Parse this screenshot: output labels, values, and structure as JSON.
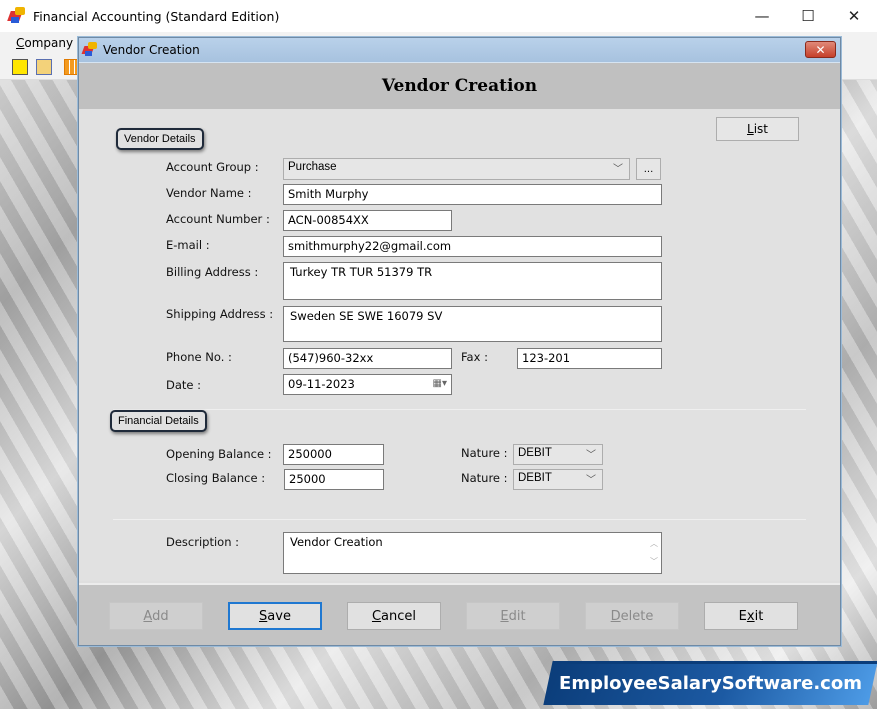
{
  "app": {
    "title": "Financial Accounting (Standard Edition)",
    "window_controls": {
      "minimize": "—",
      "maximize": "☐",
      "close": "✕"
    },
    "menu": [
      {
        "label": "Company",
        "mnemonic": "C"
      }
    ]
  },
  "dialog": {
    "title": "Vendor Creation",
    "close_label": "✕",
    "header_title": "Vendor Creation",
    "list_button": "List",
    "vendor_details": {
      "group_label": "Vendor Details",
      "account_group_label": "Account Group :",
      "account_group_value": "Purchase",
      "browse_button": "...",
      "vendor_name_label": "Vendor Name :",
      "vendor_name_value": "Smith Murphy",
      "account_number_label": "Account Number :",
      "account_number_value": "ACN-00854XX",
      "email_label": "E-mail :",
      "email_value": "smithmurphy22@gmail.com",
      "billing_label": "Billing Address :",
      "billing_value": "Turkey TR TUR 51379 TR",
      "shipping_label": "Shipping Address :",
      "shipping_value": "Sweden SE SWE 16079 SV",
      "phone_label": "Phone No. :",
      "phone_value": "(547)960-32xx",
      "fax_label": "Fax :",
      "fax_value": "123-201",
      "date_label": "Date :",
      "date_value": "09-11-2023"
    },
    "financial_details": {
      "group_label": "Financial Details",
      "opening_label": "Opening Balance :",
      "opening_value": "250000",
      "closing_label": "Closing Balance :",
      "closing_value": "25000",
      "nature_label": "Nature :",
      "opening_nature": "DEBIT",
      "closing_nature": "DEBIT"
    },
    "description_label": "Description :",
    "description_value": "Vendor Creation",
    "buttons": {
      "add": "Add",
      "save": "Save",
      "cancel": "Cancel",
      "edit": "Edit",
      "delete": "Delete",
      "exit": "Exit"
    }
  },
  "brand": {
    "text": "EmployeeSalarySoftware.com",
    "color": "#0b3d7a"
  }
}
